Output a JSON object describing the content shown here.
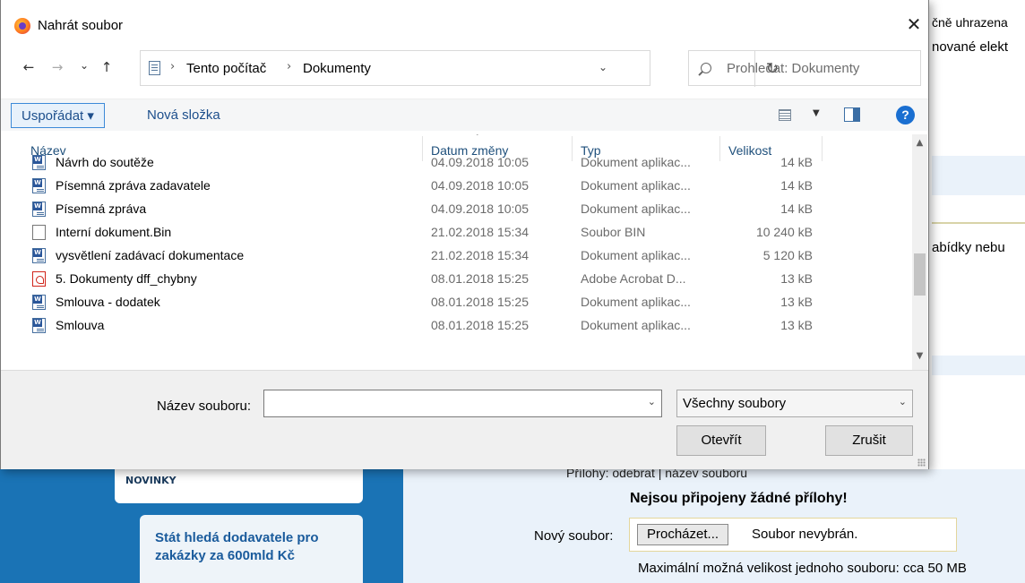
{
  "background": {
    "top_right_line1": "čně uhrazena",
    "top_right_line2": "nované elekt",
    "mid_right": "abídky nebu",
    "novinky": "NOVINKY",
    "news_card": "Stát hledá dodavatele pro zakázky za 600mld Kč",
    "prilohy_header": "Přílohy:  odebrat | název souboru",
    "no_attachments": "Nejsou připojeny žádné přílohy!",
    "new_file_label": "Nový soubor:",
    "browse_button": "Procházet...",
    "no_file_selected": "Soubor nevybrán.",
    "max_size": "Maximální možná velikost jednoho souboru: cca 50 MB"
  },
  "dialog": {
    "title": "Nahrát soubor",
    "close_icon": "close-icon",
    "nav": {
      "back": "←",
      "forward": "→",
      "recent": "⌄",
      "up": "↑"
    },
    "breadcrumb": [
      "Tento počítač",
      "Dokumenty"
    ],
    "search_placeholder": "Prohledat: Dokumenty",
    "toolbar": {
      "organize_label": "Uspořádat ▾",
      "new_folder_label": "Nová složka"
    },
    "columns": {
      "name": "Název",
      "date": "Datum změny",
      "type": "Typ",
      "size": "Velikost"
    },
    "files": [
      {
        "icon": "doc",
        "name": "Návrh do soutěže",
        "date": "04.09.2018 10:05",
        "type": "Dokument aplikac...",
        "size": "14 kB"
      },
      {
        "icon": "doc",
        "name": "Písemná zpráva zadavatele",
        "date": "04.09.2018 10:05",
        "type": "Dokument aplikac...",
        "size": "14 kB"
      },
      {
        "icon": "doc",
        "name": "Písemná zpráva",
        "date": "04.09.2018 10:05",
        "type": "Dokument aplikac...",
        "size": "14 kB"
      },
      {
        "icon": "bin",
        "name": "Interní dokument.Bin",
        "date": "21.02.2018 15:34",
        "type": "Soubor BIN",
        "size": "10 240 kB"
      },
      {
        "icon": "doc",
        "name": "vysvětlení zadávací dokumentace",
        "date": "21.02.2018 15:34",
        "type": "Dokument aplikac...",
        "size": "5 120 kB"
      },
      {
        "icon": "pdf",
        "name": "5. Dokumenty dff_chybny",
        "date": "08.01.2018 15:25",
        "type": "Adobe Acrobat D...",
        "size": "13 kB"
      },
      {
        "icon": "doc",
        "name": "Smlouva - dodatek",
        "date": "08.01.2018 15:25",
        "type": "Dokument aplikac...",
        "size": "13 kB"
      },
      {
        "icon": "doc",
        "name": "Smlouva",
        "date": "08.01.2018 15:25",
        "type": "Dokument aplikac...",
        "size": "13 kB"
      }
    ],
    "filename_label": "Název souboru:",
    "filename_value": "",
    "filter_value": "Všechny soubory",
    "open_button": "Otevřít",
    "cancel_button": "Zrušit"
  }
}
